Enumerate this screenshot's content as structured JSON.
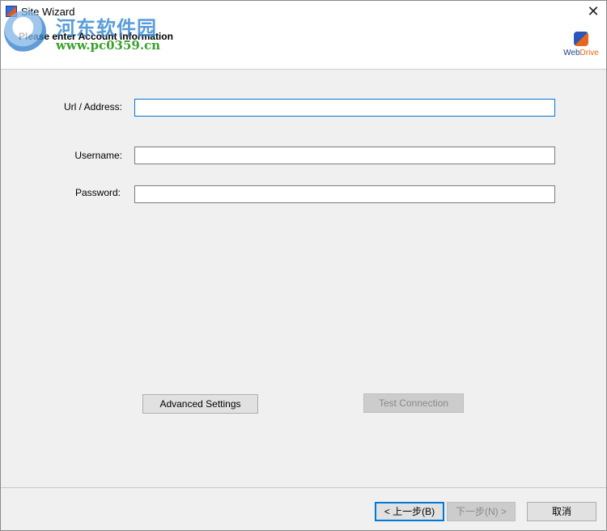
{
  "window": {
    "title": "Site Wizard",
    "close_glyph": "✕"
  },
  "header": {
    "title": "Please enter Account Information",
    "brand_name_web": "Web",
    "brand_name_drive": "Drive"
  },
  "watermark": {
    "cn_text": "河东软件园",
    "url_text": "www.pc0359.cn"
  },
  "form": {
    "url_label": "Url / Address:",
    "url_value": "",
    "username_label": "Username:",
    "username_value": "",
    "password_label": "Password:",
    "password_value": ""
  },
  "actions": {
    "advanced_label": "Advanced Settings",
    "test_label": "Test Connection"
  },
  "footer": {
    "back_label": "< 上一步(B)",
    "next_label": "下一步(N) >",
    "cancel_label": "取消"
  },
  "colors": {
    "accent": "#0078d7",
    "dialog_bg": "#f0f0f0",
    "watermark_blue": "#2f85d0",
    "watermark_green": "#3aa02e"
  }
}
